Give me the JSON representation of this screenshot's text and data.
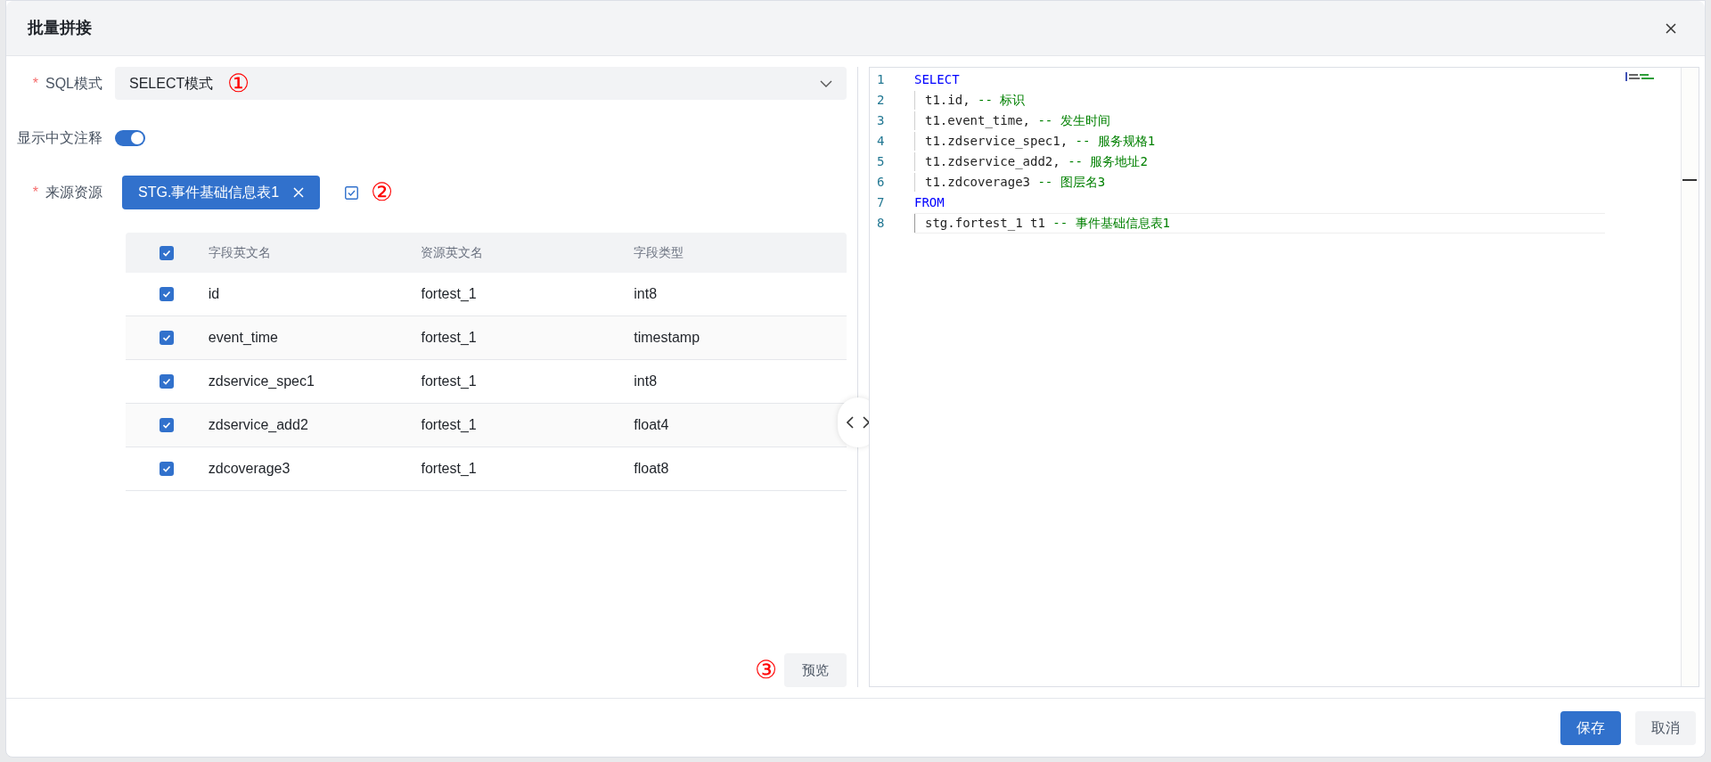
{
  "dialog": {
    "title": "批量拼接"
  },
  "sql_mode": {
    "label": "SQL模式",
    "required_mark": "*",
    "value": "SELECT模式",
    "annotation": "①"
  },
  "show_comments": {
    "label": "显示中文注释",
    "on": true
  },
  "source": {
    "label": "来源资源",
    "required_mark": "*",
    "tag": "STG.事件基础信息表1",
    "annotation": "②"
  },
  "table": {
    "all_checked": true,
    "columns": [
      "字段英文名",
      "资源英文名",
      "字段类型"
    ],
    "rows": [
      {
        "checked": true,
        "cells": [
          "id",
          "fortest_1",
          "int8"
        ]
      },
      {
        "checked": true,
        "cells": [
          "event_time",
          "fortest_1",
          "timestamp"
        ]
      },
      {
        "checked": true,
        "cells": [
          "zdservice_spec1",
          "fortest_1",
          "int8"
        ]
      },
      {
        "checked": true,
        "cells": [
          "zdservice_add2",
          "fortest_1",
          "float4"
        ]
      },
      {
        "checked": true,
        "cells": [
          "zdcoverage3",
          "fortest_1",
          "float8"
        ]
      }
    ]
  },
  "preview": {
    "label": "预览",
    "annotation": "③"
  },
  "editor": {
    "lines": [
      {
        "number": "1",
        "indent": false,
        "current": false,
        "tokens": [
          {
            "kind": "keyword",
            "text": "SELECT"
          }
        ]
      },
      {
        "number": "2",
        "indent": true,
        "current": false,
        "tokens": [
          {
            "kind": "plain",
            "text": "t1.id, "
          },
          {
            "kind": "comment",
            "text": "-- 标识"
          }
        ]
      },
      {
        "number": "3",
        "indent": true,
        "current": false,
        "tokens": [
          {
            "kind": "plain",
            "text": "t1.event_time, "
          },
          {
            "kind": "comment",
            "text": "-- 发生时间"
          }
        ]
      },
      {
        "number": "4",
        "indent": true,
        "current": false,
        "tokens": [
          {
            "kind": "plain",
            "text": "t1.zdservice_spec1, "
          },
          {
            "kind": "comment",
            "text": "-- 服务规格1"
          }
        ]
      },
      {
        "number": "5",
        "indent": true,
        "current": false,
        "tokens": [
          {
            "kind": "plain",
            "text": "t1.zdservice_add2, "
          },
          {
            "kind": "comment",
            "text": "-- 服务地址2"
          }
        ]
      },
      {
        "number": "6",
        "indent": true,
        "current": false,
        "tokens": [
          {
            "kind": "plain",
            "text": "t1.zdcoverage3 "
          },
          {
            "kind": "comment",
            "text": "-- 图层名3"
          }
        ]
      },
      {
        "number": "7",
        "indent": false,
        "current": false,
        "tokens": [
          {
            "kind": "keyword",
            "text": "FROM"
          }
        ]
      },
      {
        "number": "8",
        "indent": true,
        "current": true,
        "tokens": [
          {
            "kind": "plain",
            "text": "stg.fortest_1 t1 "
          },
          {
            "kind": "comment",
            "text": "-- 事件基础信息表1"
          }
        ]
      }
    ]
  },
  "footer": {
    "buttons": [
      {
        "label": "保存",
        "kind": "primary"
      },
      {
        "label": "取消",
        "kind": "secondary"
      }
    ]
  }
}
